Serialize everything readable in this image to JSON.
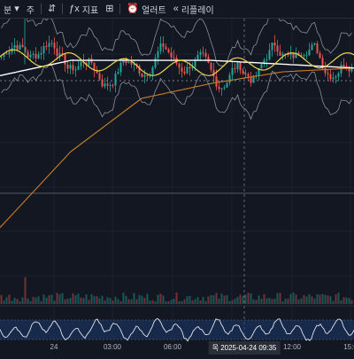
{
  "toolbar": {
    "items": [
      {
        "label": "분",
        "icon": "chevron-down-icon"
      },
      {
        "label": "주",
        "icon": ""
      },
      {
        "label": "",
        "icon": "candles-icon"
      },
      {
        "label": "지표",
        "icon": "indicator-icon"
      },
      {
        "label": "",
        "icon": "grid-icon"
      },
      {
        "label": "얼러트",
        "icon": "alarm-icon"
      },
      {
        "label": "리플레이",
        "icon": "replay-icon"
      }
    ],
    "right_icons": [
      "crosshair-icon",
      "horizontal-line-icon",
      "diagonal-line-icon",
      "rectangle-icon",
      "pitchfork-icon",
      "circle-icon",
      "text-icon",
      "zigzag-icon"
    ]
  },
  "time_axis": {
    "ticks": [
      "24",
      "03:00",
      "06:00",
      "12:00",
      "15:0"
    ],
    "cursor_label": "목 2025-04-24  09:35"
  },
  "colors": {
    "background": "#131722",
    "up": "#26a69a",
    "down": "#ef5350",
    "ma_yellow": "#e8d44d",
    "ma_white": "#ffffff",
    "ma_orange": "#c77c2a",
    "band": "#8a8e99",
    "osc_fill": "#1e3a6e"
  },
  "chart_data": {
    "type": "line",
    "x": [
      "24",
      "03:00",
      "06:00",
      "09:35",
      "12:00",
      "15:0"
    ],
    "series": [
      {
        "values": [
          1.0,
          0.99,
          0.97,
          0.97,
          0.99,
          0.99
        ]
      },
      {
        "values": [
          0.95,
          0.99,
          0.99,
          0.99,
          0.98,
          0.97
        ]
      },
      {
        "values": [
          0.55,
          0.75,
          0.89,
          0.93,
          0.96,
          0.97
        ]
      }
    ]
  }
}
